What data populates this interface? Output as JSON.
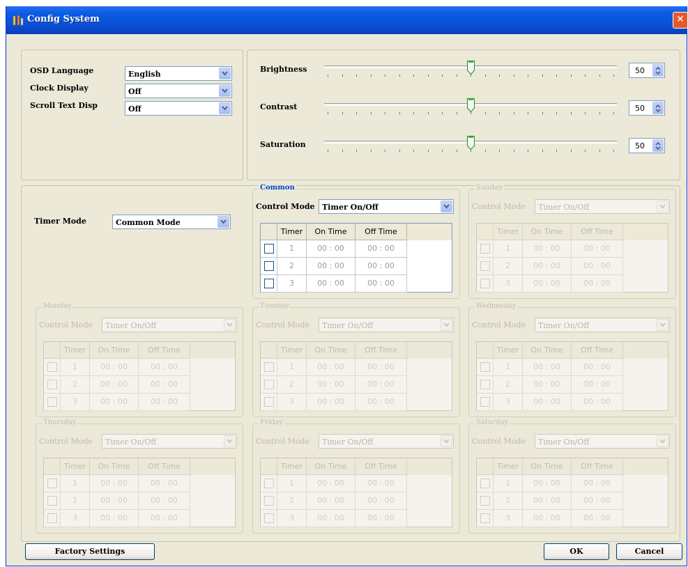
{
  "window": {
    "title": "Config System",
    "close_glyph": "✕"
  },
  "osd": {
    "rows": [
      {
        "label": "OSD Language",
        "value": "English"
      },
      {
        "label": "Clock Display",
        "value": "Off"
      },
      {
        "label": "Scroll Text Disp",
        "value": "Off"
      }
    ]
  },
  "picture": {
    "sliders": [
      {
        "label": "Brightness",
        "value": "50",
        "level": 0.5
      },
      {
        "label": "Contrast",
        "value": "50",
        "level": 0.5
      },
      {
        "label": "Saturation",
        "value": "50",
        "level": 0.5
      }
    ]
  },
  "timer": {
    "mode_label": "Timer Mode",
    "mode_value": "Common Mode",
    "control_mode_label": "Control Mode",
    "columns": [
      "Timer",
      "On Time",
      "Off Time"
    ],
    "groups": [
      {
        "name": "Common",
        "control_mode": "Timer On/Off",
        "enabled": true,
        "rows": [
          [
            "1",
            "00 : 00",
            "00 : 00"
          ],
          [
            "2",
            "00 : 00",
            "00 : 00"
          ],
          [
            "3",
            "00 : 00",
            "00 : 00"
          ]
        ]
      },
      {
        "name": "Sunday",
        "control_mode": "Timer On/Off",
        "enabled": false,
        "rows": [
          [
            "1",
            "00 : 00",
            "00 : 00"
          ],
          [
            "2",
            "00 : 00",
            "00 : 00"
          ],
          [
            "3",
            "00 : 00",
            "00 : 00"
          ]
        ]
      },
      {
        "name": "Monday",
        "control_mode": "Timer On/Off",
        "enabled": false,
        "rows": [
          [
            "1",
            "00 : 00",
            "00 : 00"
          ],
          [
            "2",
            "00 : 00",
            "00 : 00"
          ],
          [
            "3",
            "00 : 00",
            "00 : 00"
          ]
        ]
      },
      {
        "name": "Tuesday",
        "control_mode": "Timer On/Off",
        "enabled": false,
        "rows": [
          [
            "1",
            "00 : 00",
            "00 : 00"
          ],
          [
            "2",
            "00 : 00",
            "00 : 00"
          ],
          [
            "3",
            "00 : 00",
            "00 : 00"
          ]
        ]
      },
      {
        "name": "Wednesday",
        "control_mode": "Timer On/Off",
        "enabled": false,
        "rows": [
          [
            "1",
            "00 : 00",
            "00 : 00"
          ],
          [
            "2",
            "00 : 00",
            "00 : 00"
          ],
          [
            "3",
            "00 : 00",
            "00 : 00"
          ]
        ]
      },
      {
        "name": "Thursday",
        "control_mode": "Timer On/Off",
        "enabled": false,
        "rows": [
          [
            "1",
            "00 : 00",
            "00 : 00"
          ],
          [
            "2",
            "00 : 00",
            "00 : 00"
          ],
          [
            "3",
            "00 : 00",
            "00 : 00"
          ]
        ]
      },
      {
        "name": "Friday",
        "control_mode": "Timer On/Off",
        "enabled": false,
        "rows": [
          [
            "1",
            "00 : 00",
            "00 : 00"
          ],
          [
            "2",
            "00 : 00",
            "00 : 00"
          ],
          [
            "3",
            "00 : 00",
            "00 : 00"
          ]
        ]
      },
      {
        "name": "Saturday",
        "control_mode": "Timer On/Off",
        "enabled": false,
        "rows": [
          [
            "1",
            "00 : 00",
            "00 : 00"
          ],
          [
            "2",
            "00 : 00",
            "00 : 00"
          ],
          [
            "3",
            "00 : 00",
            "00 : 00"
          ]
        ]
      }
    ]
  },
  "buttons": {
    "factory": "Factory Settings",
    "ok": "OK",
    "cancel": "Cancel"
  },
  "colors": {
    "titlebar": "#0a5ce6",
    "window_bg": "#ece9d8",
    "active_group_title": "#0046d5",
    "close_button": "#e35a2c"
  }
}
